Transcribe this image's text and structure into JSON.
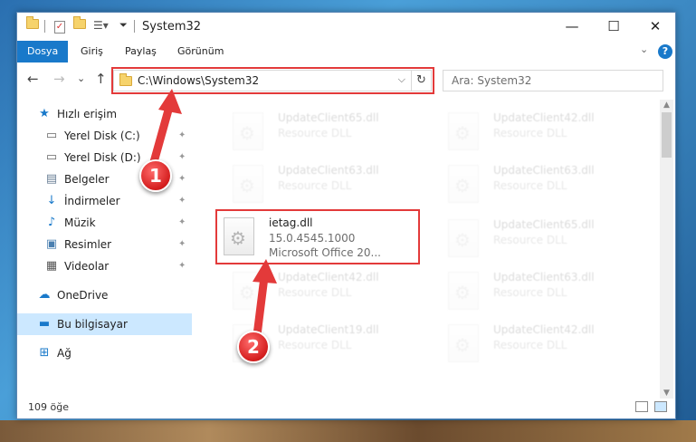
{
  "window": {
    "title": "System32",
    "minimize": "—",
    "maximize": "☐",
    "close": "✕"
  },
  "ribbon": {
    "tabs": [
      "Dosya",
      "Giriş",
      "Paylaş",
      "Görünüm"
    ],
    "active_tab": "Dosya",
    "expand": "⌄",
    "help": "?"
  },
  "address": {
    "path": "C:\\Windows\\System32",
    "refresh": "↻",
    "dropdown": "⌵"
  },
  "search": {
    "placeholder": "Ara: System32"
  },
  "nav_buttons": {
    "back": "←",
    "forward": "→",
    "recent": "⌄",
    "up": "↑"
  },
  "sidebar": {
    "items": [
      {
        "label": "Hızlı erişim",
        "icon": "star-icon",
        "glyph": "★",
        "color": "#1979ca",
        "pinned": false
      },
      {
        "label": "Yerel Disk (C:)",
        "icon": "drive-icon",
        "glyph": "▭",
        "color": "#666",
        "pinned": true
      },
      {
        "label": "Yerel Disk (D:)",
        "icon": "drive-icon",
        "glyph": "▭",
        "color": "#666",
        "pinned": true
      },
      {
        "label": "Belgeler",
        "icon": "documents-icon",
        "glyph": "▤",
        "color": "#6a7f96",
        "pinned": true
      },
      {
        "label": "İndirmeler",
        "icon": "download-icon",
        "glyph": "↓",
        "color": "#1979ca",
        "pinned": true
      },
      {
        "label": "Müzik",
        "icon": "music-icon",
        "glyph": "♪",
        "color": "#1979ca",
        "pinned": true
      },
      {
        "label": "Resimler",
        "icon": "pictures-icon",
        "glyph": "▣",
        "color": "#4a7fb0",
        "pinned": true
      },
      {
        "label": "Videolar",
        "icon": "video-icon",
        "glyph": "▦",
        "color": "#555",
        "pinned": true
      },
      {
        "label": "OneDrive",
        "icon": "cloud-icon",
        "glyph": "☁",
        "color": "#1979ca",
        "pinned": false
      },
      {
        "label": "Bu bilgisayar",
        "icon": "computer-icon",
        "glyph": "▬",
        "color": "#1979ca",
        "pinned": false,
        "selected": true
      },
      {
        "label": "Ağ",
        "icon": "network-icon",
        "glyph": "⊞",
        "color": "#1979ca",
        "pinned": false
      }
    ],
    "pin_glyph": "📌"
  },
  "files": {
    "highlighted": {
      "name": "ietag.dll",
      "version": "15.0.4545.1000",
      "description": "Microsoft Office 20..."
    },
    "left_column": [
      {
        "name": "UpdateClient65.dll",
        "type": "Resource DLL"
      },
      {
        "name": "UpdateClient63.dll",
        "type": "Resource DLL"
      },
      {
        "name": "UpdateClient42.dll",
        "type": "Resource DLL"
      },
      {
        "name": "UpdateClient19.dll",
        "type": "Resource DLL"
      }
    ],
    "right_column": [
      {
        "name": "UpdateClient42.dll",
        "type": "Resource DLL"
      },
      {
        "name": "UpdateClient63.dll",
        "type": "Resource DLL"
      },
      {
        "name": "UpdateClient65.dll",
        "type": "Resource DLL"
      },
      {
        "name": "UpdateClient63.dll",
        "type": "Resource DLL"
      },
      {
        "name": "UpdateClient42.dll",
        "type": "Resource DLL"
      }
    ]
  },
  "status": {
    "item_count": "109 öğe"
  },
  "annotations": {
    "marker_1": "1",
    "marker_2": "2",
    "color": "#e33a3a"
  }
}
